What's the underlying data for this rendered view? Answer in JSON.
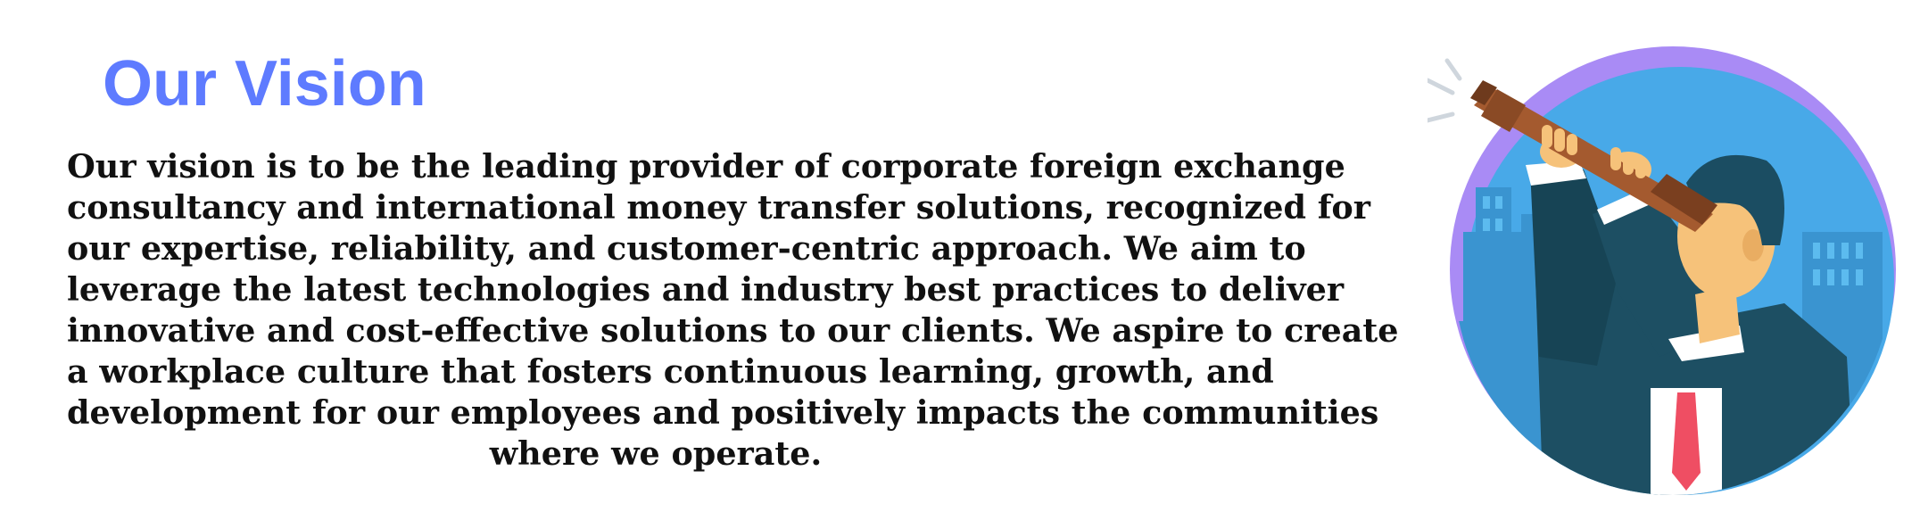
{
  "vision": {
    "heading": "Our Vision",
    "paragraph_lines": [
      "Our vision is to be the leading provider of corporate foreign exchange",
      "consultancy and international money transfer solutions, recognized for",
      "our expertise, reliability, and customer-centric approach. We aim to",
      "leverage the latest technologies and industry best practices to deliver",
      "innovative and cost-effective solutions to our clients. We aspire to create",
      "a workplace culture that fosters continuous learning, growth, and",
      "development for our employees and positively impacts the communities",
      "where we operate."
    ]
  },
  "colors": {
    "heading": "#5e7bff",
    "text": "#111111",
    "circle_outer": "#a98bf5",
    "circle_inner": "#48a9e8",
    "suit": "#1d4f63",
    "tie": "#ef4e63",
    "telescope": "#a45a2f"
  },
  "illustration": {
    "icon": "businessman-with-telescope-icon"
  }
}
